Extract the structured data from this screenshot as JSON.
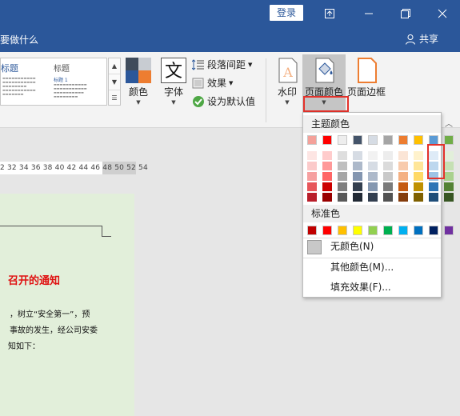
{
  "titlebar": {
    "login_label": "登录"
  },
  "menubar": {
    "tellme_text": "要做什么",
    "share_label": "共享"
  },
  "gallery": {
    "style1_title": "标题",
    "style2_title": "标题",
    "style2_snippet": "标题 1"
  },
  "ribbon": {
    "colors_label": "颜色",
    "fonts_label": "字体",
    "paragraph_spacing_label": "段落间距",
    "effects_label": "效果",
    "set_default_label": "设为默认值",
    "watermark_label": "水印",
    "page_color_label": "页面颜色",
    "page_borders_label": "页面边框"
  },
  "ruler": {
    "numbers": "2  32  34  36  38  40  42  44  46  48  50  52  54"
  },
  "document": {
    "heading": "召开的通知",
    "line1": "，树立“安全第一”，预",
    "line2": "事故的发生，经公司安委",
    "line3": "知如下："
  },
  "dropdown": {
    "theme_colors_label": "主题颜色",
    "standard_colors_label": "标准色",
    "no_color_label": "无颜色(N)",
    "more_colors_label": "其他颜色(M)...",
    "fill_effects_label": "填充效果(F)...",
    "theme_top": [
      "#f4a19a",
      "#ff0000",
      "#eeeeee",
      "#44546a",
      "#d6dce4",
      "#a5a5a5",
      "#ed7d31",
      "#ffc000",
      "#5b9bd5",
      "#70ad47"
    ],
    "theme_shades": [
      [
        "#fde5e3",
        "#fbcaca",
        "#f6a0a0",
        "#e7565a",
        "#b91e2a"
      ],
      [
        "#ffcccc",
        "#ff9999",
        "#ff6666",
        "#cc0000",
        "#990000"
      ],
      [
        "#dedede",
        "#bfbfbf",
        "#a6a6a6",
        "#7f7f7f",
        "#595959"
      ],
      [
        "#d6dce4",
        "#adb9ca",
        "#8496b0",
        "#333f4f",
        "#222a35"
      ],
      [
        "#f2f2f2",
        "#d6dce4",
        "#adb9ca",
        "#8497b0",
        "#333f50"
      ],
      [
        "#ededed",
        "#dbdbdb",
        "#c9c9c9",
        "#7b7b7b",
        "#525252"
      ],
      [
        "#fbe5d6",
        "#f8cbad",
        "#f4b183",
        "#c55a11",
        "#843c0c"
      ],
      [
        "#fff2cc",
        "#ffe699",
        "#ffd966",
        "#bf9000",
        "#7f6000"
      ],
      [
        "#deebf7",
        "#bdd7ee",
        "#9dc3e6",
        "#2e75b6",
        "#1f4e79"
      ],
      [
        "#e2efda",
        "#c5e0b4",
        "#a9d18e",
        "#548235",
        "#375623"
      ]
    ],
    "standard": [
      "#c00000",
      "#ff0000",
      "#ffc000",
      "#ffff00",
      "#92d050",
      "#00b050",
      "#00b0f0",
      "#0070c0",
      "#002060",
      "#7030a0"
    ]
  }
}
